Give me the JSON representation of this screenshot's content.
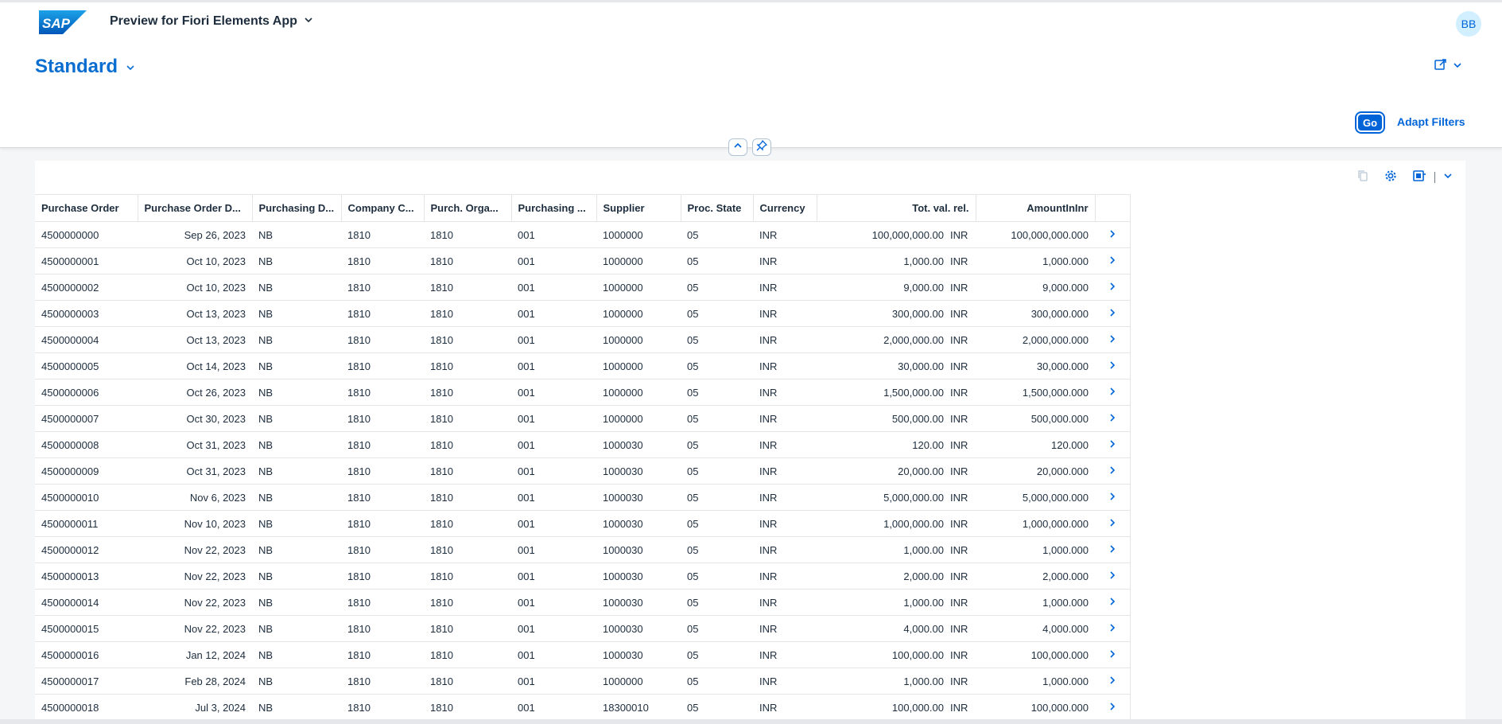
{
  "shell": {
    "app_title": "Preview for Fiori Elements App",
    "avatar_initials": "BB",
    "logo_text": "SAP"
  },
  "header": {
    "variant_name": "Standard",
    "go_label": "Go",
    "adapt_filters_label": "Adapt Filters"
  },
  "colors": {
    "brand": "#0064d9",
    "link": "#0a6ed1"
  },
  "table": {
    "columns": [
      "Purchase Order",
      "Purchase Order D...",
      "Purchasing D...",
      "Company C...",
      "Purch. Orga...",
      "Purchasing ...",
      "Supplier",
      "Proc. State",
      "Currency",
      "Tot. val. rel.",
      "AmountInInr"
    ],
    "rows": [
      [
        "4500000000",
        "Sep 26, 2023",
        "NB",
        "1810",
        "1810",
        "001",
        "1000000",
        "05",
        "INR",
        "100,000,000.00",
        "INR",
        "100,000,000.000"
      ],
      [
        "4500000001",
        "Oct 10, 2023",
        "NB",
        "1810",
        "1810",
        "001",
        "1000000",
        "05",
        "INR",
        "1,000.00",
        "INR",
        "1,000.000"
      ],
      [
        "4500000002",
        "Oct 10, 2023",
        "NB",
        "1810",
        "1810",
        "001",
        "1000000",
        "05",
        "INR",
        "9,000.00",
        "INR",
        "9,000.000"
      ],
      [
        "4500000003",
        "Oct 13, 2023",
        "NB",
        "1810",
        "1810",
        "001",
        "1000000",
        "05",
        "INR",
        "300,000.00",
        "INR",
        "300,000.000"
      ],
      [
        "4500000004",
        "Oct 13, 2023",
        "NB",
        "1810",
        "1810",
        "001",
        "1000000",
        "05",
        "INR",
        "2,000,000.00",
        "INR",
        "2,000,000.000"
      ],
      [
        "4500000005",
        "Oct 14, 2023",
        "NB",
        "1810",
        "1810",
        "001",
        "1000000",
        "05",
        "INR",
        "30,000.00",
        "INR",
        "30,000.000"
      ],
      [
        "4500000006",
        "Oct 26, 2023",
        "NB",
        "1810",
        "1810",
        "001",
        "1000000",
        "05",
        "INR",
        "1,500,000.00",
        "INR",
        "1,500,000.000"
      ],
      [
        "4500000007",
        "Oct 30, 2023",
        "NB",
        "1810",
        "1810",
        "001",
        "1000000",
        "05",
        "INR",
        "500,000.00",
        "INR",
        "500,000.000"
      ],
      [
        "4500000008",
        "Oct 31, 2023",
        "NB",
        "1810",
        "1810",
        "001",
        "1000030",
        "05",
        "INR",
        "120.00",
        "INR",
        "120.000"
      ],
      [
        "4500000009",
        "Oct 31, 2023",
        "NB",
        "1810",
        "1810",
        "001",
        "1000030",
        "05",
        "INR",
        "20,000.00",
        "INR",
        "20,000.000"
      ],
      [
        "4500000010",
        "Nov 6, 2023",
        "NB",
        "1810",
        "1810",
        "001",
        "1000030",
        "05",
        "INR",
        "5,000,000.00",
        "INR",
        "5,000,000.000"
      ],
      [
        "4500000011",
        "Nov 10, 2023",
        "NB",
        "1810",
        "1810",
        "001",
        "1000030",
        "05",
        "INR",
        "1,000,000.00",
        "INR",
        "1,000,000.000"
      ],
      [
        "4500000012",
        "Nov 22, 2023",
        "NB",
        "1810",
        "1810",
        "001",
        "1000030",
        "05",
        "INR",
        "1,000.00",
        "INR",
        "1,000.000"
      ],
      [
        "4500000013",
        "Nov 22, 2023",
        "NB",
        "1810",
        "1810",
        "001",
        "1000030",
        "05",
        "INR",
        "2,000.00",
        "INR",
        "2,000.000"
      ],
      [
        "4500000014",
        "Nov 22, 2023",
        "NB",
        "1810",
        "1810",
        "001",
        "1000030",
        "05",
        "INR",
        "1,000.00",
        "INR",
        "1,000.000"
      ],
      [
        "4500000015",
        "Nov 22, 2023",
        "NB",
        "1810",
        "1810",
        "001",
        "1000030",
        "05",
        "INR",
        "4,000.00",
        "INR",
        "4,000.000"
      ],
      [
        "4500000016",
        "Jan 12, 2024",
        "NB",
        "1810",
        "1810",
        "001",
        "1000030",
        "05",
        "INR",
        "100,000.00",
        "INR",
        "100,000.000"
      ],
      [
        "4500000017",
        "Feb 28, 2024",
        "NB",
        "1810",
        "1810",
        "001",
        "1000000",
        "05",
        "INR",
        "1,000.00",
        "INR",
        "1,000.000"
      ],
      [
        "4500000018",
        "Jul 3, 2024",
        "NB",
        "1810",
        "1810",
        "001",
        "18300010",
        "05",
        "INR",
        "100,000.00",
        "INR",
        "100,000.000"
      ]
    ]
  },
  "icons": {
    "app_menu": "chevron-down-icon",
    "variant_menu": "chevron-down-icon",
    "share": "share-icon",
    "collapse_header": "chevron-up-icon",
    "pin_header": "pin-icon",
    "copy": "copy-icon",
    "settings": "gear-icon",
    "export": "export-icon",
    "row_nav": "chevron-right-icon"
  }
}
